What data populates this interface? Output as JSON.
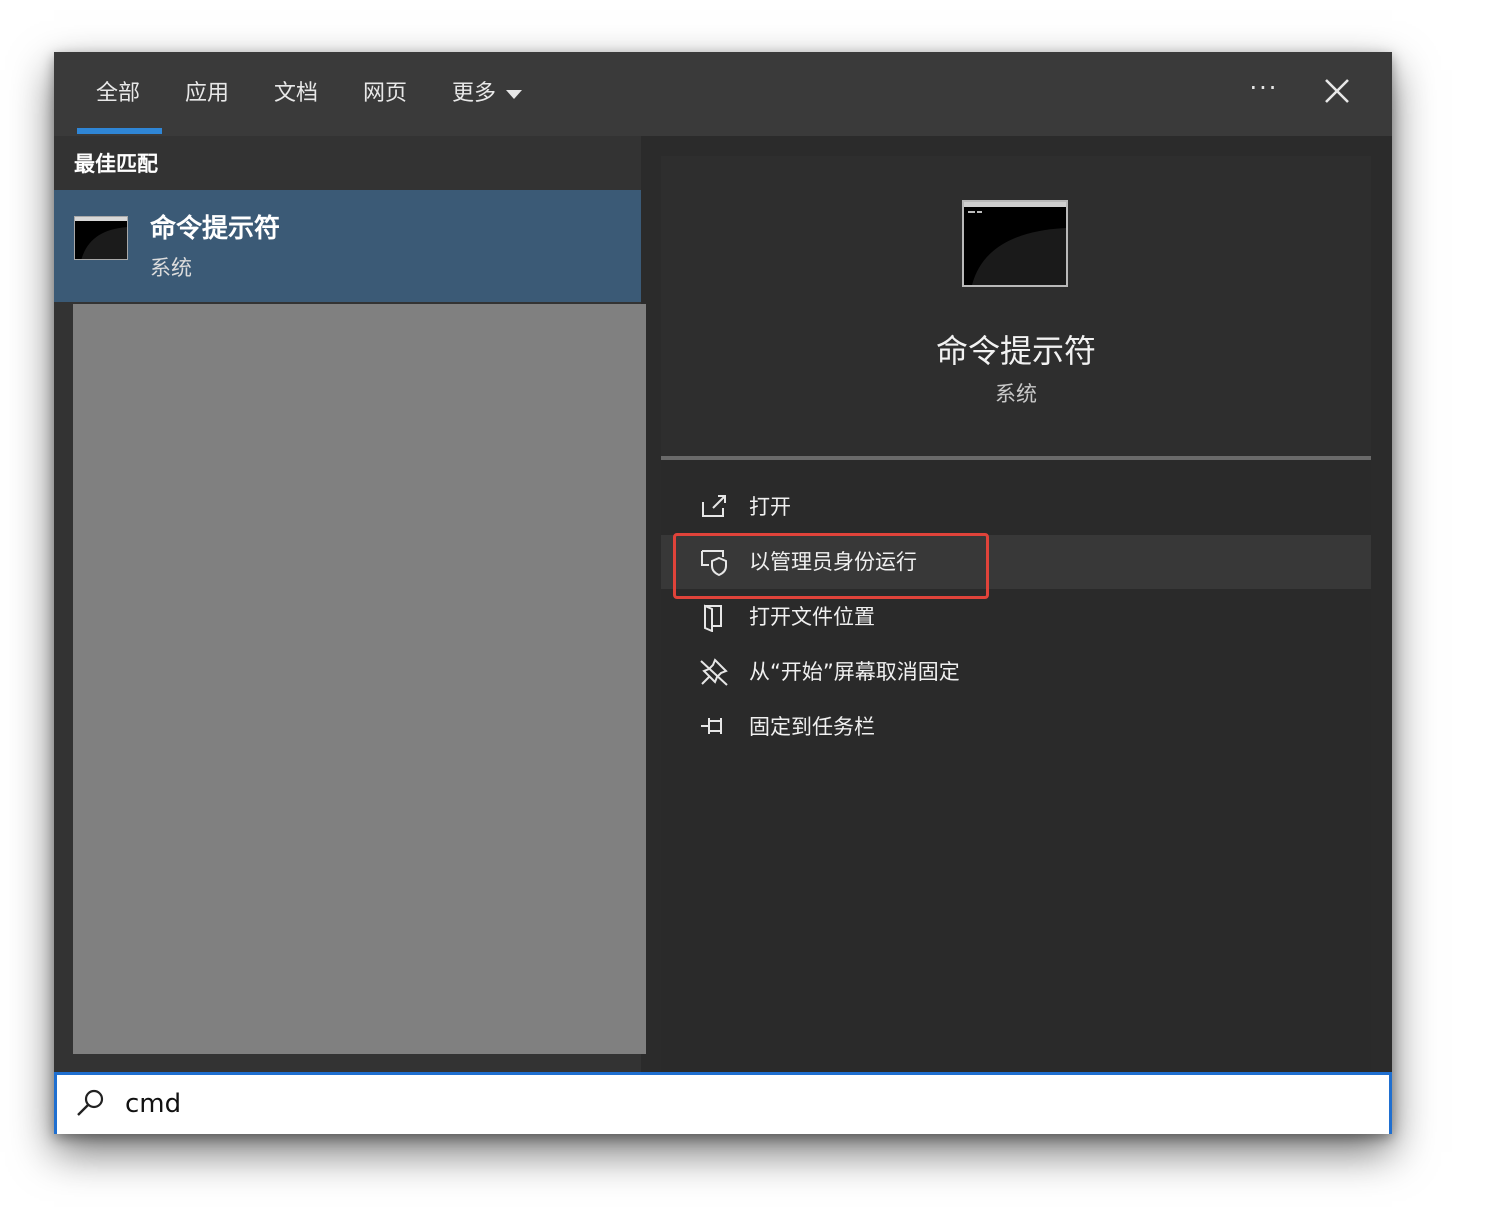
{
  "tabs": [
    {
      "label": "全部"
    },
    {
      "label": "应用"
    },
    {
      "label": "文档"
    },
    {
      "label": "网页"
    },
    {
      "label": "更多"
    }
  ],
  "header": {
    "more_options": "···"
  },
  "best_match": {
    "section_label": "最佳匹配",
    "title": "命令提示符",
    "subtitle": "系统"
  },
  "preview": {
    "title": "命令提示符",
    "subtitle": "系统"
  },
  "actions": [
    {
      "label": "打开",
      "icon": "open-icon"
    },
    {
      "label": "以管理员身份运行",
      "icon": "run-as-admin-shield-icon"
    },
    {
      "label": "打开文件位置",
      "icon": "file-location-icon"
    },
    {
      "label": "从“开始”屏幕取消固定",
      "icon": "unpin-icon"
    },
    {
      "label": "固定到任务栏",
      "icon": "pin-icon"
    }
  ],
  "search": {
    "value": "cmd"
  },
  "colors": {
    "accent": "#2f86d6",
    "selected_item": "#3b5a76",
    "highlight_box": "#e0433a"
  }
}
